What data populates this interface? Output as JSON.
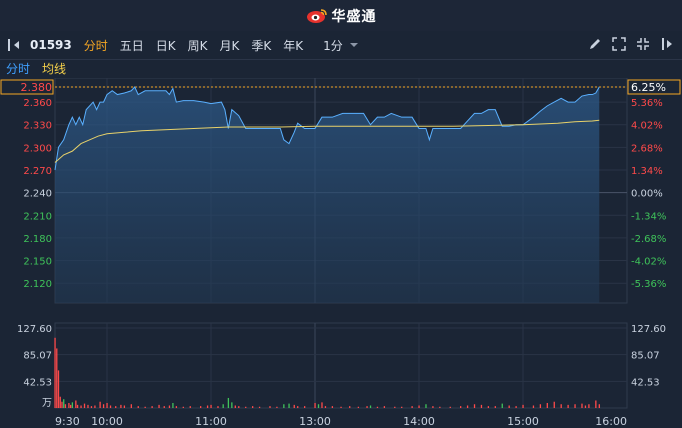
{
  "brand": {
    "name": "华盛通",
    "logo_icon": "weibo-eye-logo"
  },
  "toolbar": {
    "stock_code": "01593",
    "tabs": [
      "分时",
      "五日",
      "日K",
      "周K",
      "月K",
      "季K",
      "年K"
    ],
    "active_tab": 0,
    "period": "1分",
    "icons": [
      "draw-pen-icon",
      "expand-icon",
      "fullscreen-icon",
      "close-icon"
    ]
  },
  "subtabs": {
    "timeshare": "分时",
    "avg_line": "均线"
  },
  "colors": {
    "bg": "#1b2535",
    "up": "#ff4a4a",
    "down": "#3fc35a",
    "neutral": "#c9d2df",
    "price_line": "#5ab0ff",
    "avg_line": "#e8d26a",
    "accent": "#f5a623"
  },
  "chart_data": {
    "type": "line",
    "current_price": "2.380",
    "current_pct": "6.25%",
    "y_price_labels": [
      "2.380",
      "2.360",
      "2.330",
      "2.300",
      "2.270",
      "2.240",
      "2.210",
      "2.180",
      "2.150",
      "2.120"
    ],
    "y_pct_labels": [
      "6.25%",
      "5.36%",
      "4.02%",
      "2.68%",
      "1.34%",
      "0.00%",
      "-1.34%",
      "-2.68%",
      "-4.02%",
      "-5.36%"
    ],
    "y_price_values": [
      2.38,
      2.36,
      2.33,
      2.3,
      2.27,
      2.24,
      2.21,
      2.18,
      2.15,
      2.12
    ],
    "ylim": [
      2.107,
      2.38
    ],
    "base_price": 2.24,
    "x_labels": [
      "9:30",
      "10:00",
      "11:00",
      "13:00",
      "14:00",
      "15:00",
      "16:00"
    ],
    "x_label_index": [
      0,
      30,
      90,
      150,
      210,
      270,
      330
    ],
    "total_points": 331,
    "price_series": [
      [
        0,
        2.27
      ],
      [
        2,
        2.3
      ],
      [
        5,
        2.31
      ],
      [
        8,
        2.33
      ],
      [
        10,
        2.34
      ],
      [
        12,
        2.33
      ],
      [
        14,
        2.34
      ],
      [
        16,
        2.33
      ],
      [
        18,
        2.35
      ],
      [
        22,
        2.36
      ],
      [
        24,
        2.35
      ],
      [
        26,
        2.36
      ],
      [
        28,
        2.36
      ],
      [
        30,
        2.37
      ],
      [
        33,
        2.375
      ],
      [
        36,
        2.37
      ],
      [
        40,
        2.372
      ],
      [
        44,
        2.375
      ],
      [
        46,
        2.38
      ],
      [
        48,
        2.37
      ],
      [
        52,
        2.375
      ],
      [
        56,
        2.375
      ],
      [
        60,
        2.375
      ],
      [
        64,
        2.375
      ],
      [
        66,
        2.37
      ],
      [
        68,
        2.378
      ],
      [
        70,
        2.36
      ],
      [
        74,
        2.362
      ],
      [
        80,
        2.362
      ],
      [
        86,
        2.36
      ],
      [
        90,
        2.358
      ],
      [
        96,
        2.36
      ],
      [
        98,
        2.35
      ],
      [
        100,
        2.325
      ],
      [
        102,
        2.35
      ],
      [
        106,
        2.342
      ],
      [
        110,
        2.325
      ],
      [
        114,
        2.325
      ],
      [
        118,
        2.325
      ],
      [
        122,
        2.325
      ],
      [
        126,
        2.325
      ],
      [
        130,
        2.325
      ],
      [
        132,
        2.31
      ],
      [
        135,
        2.305
      ],
      [
        138,
        2.32
      ],
      [
        140,
        2.332
      ],
      [
        144,
        2.325
      ],
      [
        150,
        2.325
      ],
      [
        154,
        2.34
      ],
      [
        160,
        2.34
      ],
      [
        166,
        2.345
      ],
      [
        170,
        2.345
      ],
      [
        174,
        2.345
      ],
      [
        178,
        2.345
      ],
      [
        182,
        2.33
      ],
      [
        186,
        2.34
      ],
      [
        190,
        2.34
      ],
      [
        194,
        2.345
      ],
      [
        200,
        2.34
      ],
      [
        206,
        2.34
      ],
      [
        210,
        2.325
      ],
      [
        214,
        2.325
      ],
      [
        216,
        2.31
      ],
      [
        218,
        2.325
      ],
      [
        222,
        2.325
      ],
      [
        226,
        2.325
      ],
      [
        230,
        2.325
      ],
      [
        234,
        2.325
      ],
      [
        238,
        2.335
      ],
      [
        242,
        2.345
      ],
      [
        246,
        2.345
      ],
      [
        250,
        2.35
      ],
      [
        254,
        2.35
      ],
      [
        258,
        2.328
      ],
      [
        262,
        2.328
      ],
      [
        266,
        2.33
      ],
      [
        270,
        2.33
      ],
      [
        276,
        2.34
      ],
      [
        280,
        2.348
      ],
      [
        284,
        2.355
      ],
      [
        288,
        2.36
      ],
      [
        292,
        2.365
      ],
      [
        296,
        2.36
      ],
      [
        300,
        2.36
      ],
      [
        304,
        2.368
      ],
      [
        308,
        2.37
      ],
      [
        310,
        2.37
      ],
      [
        312,
        2.372
      ],
      [
        314,
        2.38
      ]
    ],
    "avg_series": [
      [
        0,
        2.28
      ],
      [
        5,
        2.29
      ],
      [
        10,
        2.295
      ],
      [
        15,
        2.305
      ],
      [
        20,
        2.31
      ],
      [
        25,
        2.315
      ],
      [
        30,
        2.318
      ],
      [
        40,
        2.32
      ],
      [
        50,
        2.322
      ],
      [
        60,
        2.323
      ],
      [
        70,
        2.324
      ],
      [
        80,
        2.325
      ],
      [
        90,
        2.326
      ],
      [
        100,
        2.327
      ],
      [
        110,
        2.327
      ],
      [
        120,
        2.327
      ],
      [
        130,
        2.327
      ],
      [
        150,
        2.328
      ],
      [
        170,
        2.328
      ],
      [
        190,
        2.328
      ],
      [
        210,
        2.328
      ],
      [
        230,
        2.328
      ],
      [
        250,
        2.329
      ],
      [
        270,
        2.33
      ],
      [
        290,
        2.332
      ],
      [
        300,
        2.334
      ],
      [
        310,
        2.335
      ],
      [
        314,
        2.336
      ]
    ],
    "volume_labels": [
      "127.60",
      "85.07",
      "42.53",
      "万"
    ],
    "volume_values": [
      127.6,
      85.07,
      42.53
    ],
    "volume_unit": "万",
    "volume_max": 127.6,
    "volume_bars": [
      [
        0,
        112,
        "up"
      ],
      [
        1,
        95,
        "up"
      ],
      [
        2,
        60,
        "up"
      ],
      [
        3,
        18,
        "up"
      ],
      [
        4,
        10,
        "up"
      ],
      [
        5,
        14,
        "down"
      ],
      [
        6,
        6,
        "up"
      ],
      [
        8,
        8,
        "up"
      ],
      [
        9,
        5,
        "up"
      ],
      [
        10,
        9,
        "down"
      ],
      [
        12,
        12,
        "up"
      ],
      [
        13,
        5,
        "up"
      ],
      [
        15,
        4,
        "up"
      ],
      [
        17,
        7,
        "up"
      ],
      [
        19,
        5,
        "up"
      ],
      [
        21,
        3,
        "up"
      ],
      [
        23,
        4,
        "up"
      ],
      [
        26,
        10,
        "up"
      ],
      [
        28,
        6,
        "up"
      ],
      [
        30,
        8,
        "up"
      ],
      [
        32,
        4,
        "up"
      ],
      [
        35,
        3,
        "up"
      ],
      [
        38,
        5,
        "up"
      ],
      [
        40,
        4,
        "up"
      ],
      [
        44,
        6,
        "up"
      ],
      [
        48,
        3,
        "up"
      ],
      [
        52,
        2,
        "up"
      ],
      [
        56,
        3,
        "up"
      ],
      [
        60,
        5,
        "up"
      ],
      [
        63,
        3,
        "up"
      ],
      [
        66,
        4,
        "up"
      ],
      [
        68,
        8,
        "down"
      ],
      [
        70,
        3,
        "up"
      ],
      [
        74,
        2,
        "up"
      ],
      [
        78,
        3,
        "up"
      ],
      [
        84,
        3,
        "up"
      ],
      [
        88,
        4,
        "up"
      ],
      [
        90,
        5,
        "up"
      ],
      [
        94,
        3,
        "up"
      ],
      [
        97,
        6,
        "down"
      ],
      [
        100,
        16,
        "down"
      ],
      [
        102,
        9,
        "down"
      ],
      [
        104,
        4,
        "up"
      ],
      [
        106,
        3,
        "up"
      ],
      [
        110,
        2,
        "up"
      ],
      [
        114,
        3,
        "up"
      ],
      [
        118,
        2,
        "up"
      ],
      [
        124,
        3,
        "up"
      ],
      [
        128,
        2,
        "up"
      ],
      [
        132,
        6,
        "down"
      ],
      [
        135,
        7,
        "down"
      ],
      [
        138,
        5,
        "up"
      ],
      [
        140,
        3,
        "up"
      ],
      [
        144,
        3,
        "up"
      ],
      [
        150,
        8,
        "up"
      ],
      [
        152,
        6,
        "down"
      ],
      [
        154,
        9,
        "up"
      ],
      [
        156,
        3,
        "up"
      ],
      [
        160,
        3,
        "up"
      ],
      [
        165,
        2,
        "up"
      ],
      [
        170,
        3,
        "up"
      ],
      [
        175,
        2,
        "up"
      ],
      [
        180,
        3,
        "up"
      ],
      [
        182,
        4,
        "down"
      ],
      [
        186,
        2,
        "up"
      ],
      [
        190,
        3,
        "up"
      ],
      [
        196,
        2,
        "up"
      ],
      [
        200,
        2,
        "up"
      ],
      [
        206,
        3,
        "up"
      ],
      [
        210,
        4,
        "up"
      ],
      [
        214,
        6,
        "down"
      ],
      [
        218,
        3,
        "up"
      ],
      [
        222,
        2,
        "up"
      ],
      [
        228,
        2,
        "up"
      ],
      [
        234,
        3,
        "up"
      ],
      [
        238,
        4,
        "up"
      ],
      [
        242,
        6,
        "up"
      ],
      [
        246,
        5,
        "up"
      ],
      [
        250,
        3,
        "up"
      ],
      [
        254,
        3,
        "up"
      ],
      [
        258,
        7,
        "down"
      ],
      [
        262,
        4,
        "up"
      ],
      [
        266,
        3,
        "up"
      ],
      [
        270,
        5,
        "up"
      ],
      [
        276,
        4,
        "up"
      ],
      [
        280,
        6,
        "up"
      ],
      [
        284,
        8,
        "up"
      ],
      [
        288,
        10,
        "up"
      ],
      [
        292,
        6,
        "up"
      ],
      [
        296,
        5,
        "up"
      ],
      [
        300,
        6,
        "up"
      ],
      [
        304,
        7,
        "up"
      ],
      [
        306,
        4,
        "up"
      ],
      [
        308,
        6,
        "up"
      ],
      [
        312,
        12,
        "up"
      ],
      [
        314,
        6,
        "up"
      ]
    ]
  }
}
